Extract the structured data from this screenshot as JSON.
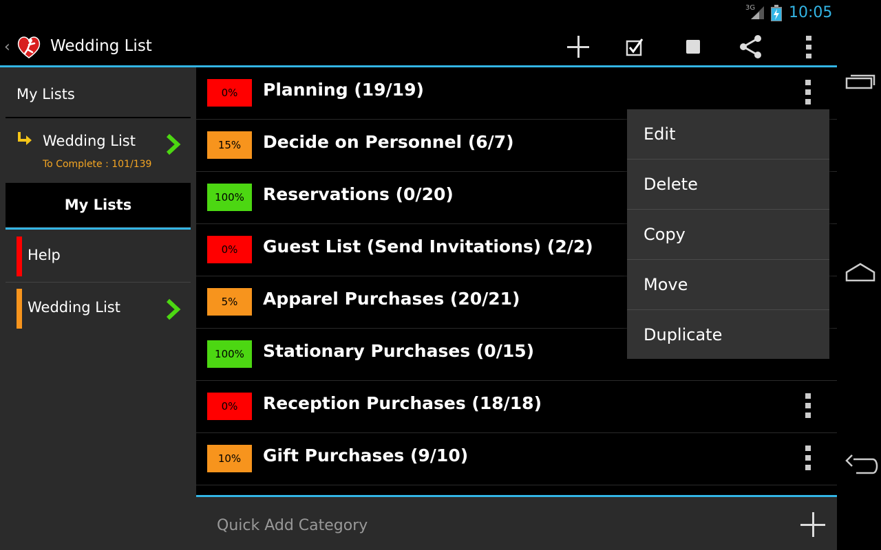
{
  "status": {
    "network": "3G",
    "time": "10:05"
  },
  "actionbar": {
    "title": "Wedding List"
  },
  "leftpanel": {
    "header": "My Lists",
    "current": {
      "name": "Wedding List",
      "subtitle": "To Complete : 101/139"
    },
    "tab_label": "My Lists",
    "items": [
      {
        "label": "Help",
        "color": "#ff0000"
      },
      {
        "label": "Wedding List",
        "color": "#f7941d"
      }
    ]
  },
  "categories": [
    {
      "percent": "0%",
      "percent_value": 0,
      "title": "Planning (19/19)",
      "color": "#ff0000"
    },
    {
      "percent": "15%",
      "percent_value": 15,
      "title": "Decide on Personnel (6/7)",
      "color": "#f7941d"
    },
    {
      "percent": "100%",
      "percent_value": 100,
      "title": "Reservations (0/20)",
      "color": "#4cd712"
    },
    {
      "percent": "0%",
      "percent_value": 0,
      "title": "Guest List (Send Invitations) (2/2)",
      "color": "#ff0000"
    },
    {
      "percent": "5%",
      "percent_value": 5,
      "title": "Apparel Purchases (20/21)",
      "color": "#f7941d"
    },
    {
      "percent": "100%",
      "percent_value": 100,
      "title": "Stationary Purchases (0/15)",
      "color": "#4cd712"
    },
    {
      "percent": "0%",
      "percent_value": 0,
      "title": "Reception Purchases (18/18)",
      "color": "#ff0000"
    },
    {
      "percent": "10%",
      "percent_value": 10,
      "title": "Gift Purchases (9/10)",
      "color": "#f7941d"
    }
  ],
  "popup": {
    "items": [
      "Edit",
      "Delete",
      "Copy",
      "Move",
      "Duplicate"
    ]
  },
  "quickadd": {
    "placeholder": "Quick Add Category",
    "value": ""
  },
  "colors": {
    "accent": "#33b5e5",
    "panel": "#2b2b2b",
    "progress_green": "#4cd712",
    "progress_orange": "#f7941d",
    "progress_red": "#ff0000",
    "subtitle_orange": "#f5a623"
  }
}
